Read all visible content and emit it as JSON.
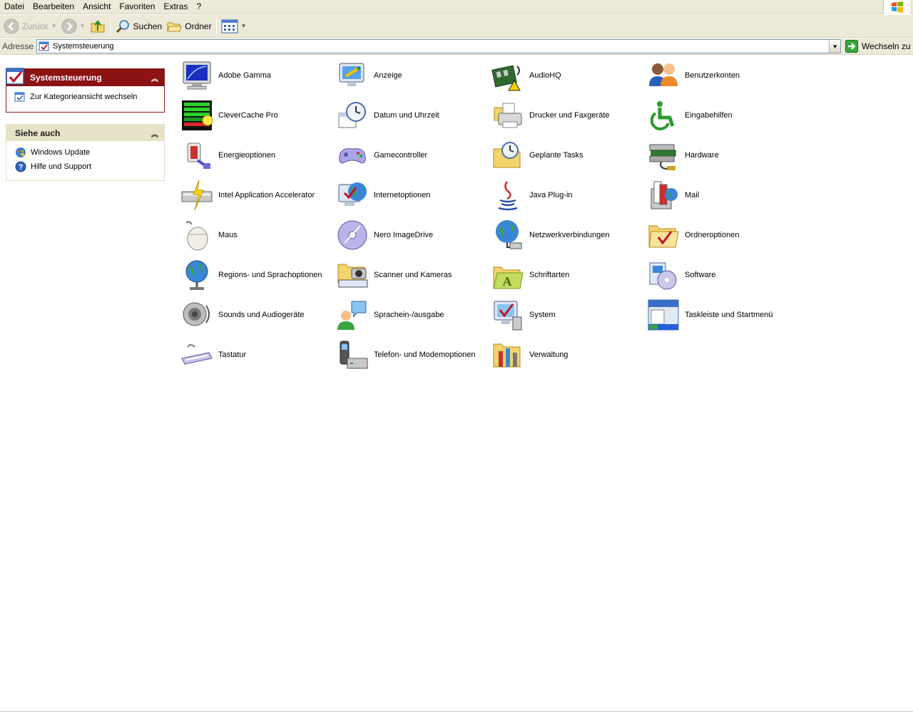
{
  "menu": [
    "Datei",
    "Bearbeiten",
    "Ansicht",
    "Favoriten",
    "Extras",
    "?"
  ],
  "toolbar": {
    "back_label": "Zurück",
    "search_label": "Suchen",
    "folders_label": "Ordner"
  },
  "address": {
    "label": "Adresse",
    "value": "Systemsteuerung",
    "go_label": "Wechseln zu"
  },
  "sidebar": {
    "panel_title": "Systemsteuerung",
    "panel_link": "Zur Kategorieansicht wechseln",
    "see_also_title": "Siehe auch",
    "see_also": [
      "Windows Update",
      "Hilfe und Support"
    ]
  },
  "items": [
    {
      "label": "Adobe Gamma",
      "icon": "adobe-gamma-icon"
    },
    {
      "label": "Anzeige",
      "icon": "display-icon"
    },
    {
      "label": "AudioHQ",
      "icon": "audiohq-icon"
    },
    {
      "label": "Benutzerkonten",
      "icon": "user-accounts-icon"
    },
    {
      "label": "CleverCache Pro",
      "icon": "clevercache-icon"
    },
    {
      "label": "Datum und Uhrzeit",
      "icon": "date-time-icon"
    },
    {
      "label": "Drucker und Faxgeräte",
      "icon": "printer-icon"
    },
    {
      "label": "Eingabehilfen",
      "icon": "accessibility-icon"
    },
    {
      "label": "Energieoptionen",
      "icon": "power-icon"
    },
    {
      "label": "Gamecontroller",
      "icon": "gamepad-icon"
    },
    {
      "label": "Geplante Tasks",
      "icon": "scheduled-tasks-icon"
    },
    {
      "label": "Hardware",
      "icon": "hardware-icon"
    },
    {
      "label": "Intel Application Accelerator",
      "icon": "intel-accelerator-icon"
    },
    {
      "label": "Internetoptionen",
      "icon": "internet-options-icon"
    },
    {
      "label": "Java Plug-in",
      "icon": "java-icon"
    },
    {
      "label": "Mail",
      "icon": "mail-icon"
    },
    {
      "label": "Maus",
      "icon": "mouse-icon"
    },
    {
      "label": "Nero ImageDrive",
      "icon": "nero-disc-icon"
    },
    {
      "label": "Netzwerkverbindungen",
      "icon": "network-icon"
    },
    {
      "label": "Ordneroptionen",
      "icon": "folder-options-icon"
    },
    {
      "label": "Regions- und Sprachoptionen",
      "icon": "regional-globe-icon"
    },
    {
      "label": "Scanner und Kameras",
      "icon": "scanner-camera-icon"
    },
    {
      "label": "Schriftarten",
      "icon": "fonts-folder-icon"
    },
    {
      "label": "Software",
      "icon": "software-icon"
    },
    {
      "label": "Sounds und Audiogeräte",
      "icon": "speaker-icon"
    },
    {
      "label": "Sprachein-/ausgabe",
      "icon": "speech-icon"
    },
    {
      "label": "System",
      "icon": "system-icon"
    },
    {
      "label": "Taskleiste und Startmenü",
      "icon": "taskbar-icon"
    },
    {
      "label": "Tastatur",
      "icon": "keyboard-icon"
    },
    {
      "label": "Telefon- und Modemoptionen",
      "icon": "phone-modem-icon"
    },
    {
      "label": "Verwaltung",
      "icon": "admin-tools-icon"
    }
  ]
}
